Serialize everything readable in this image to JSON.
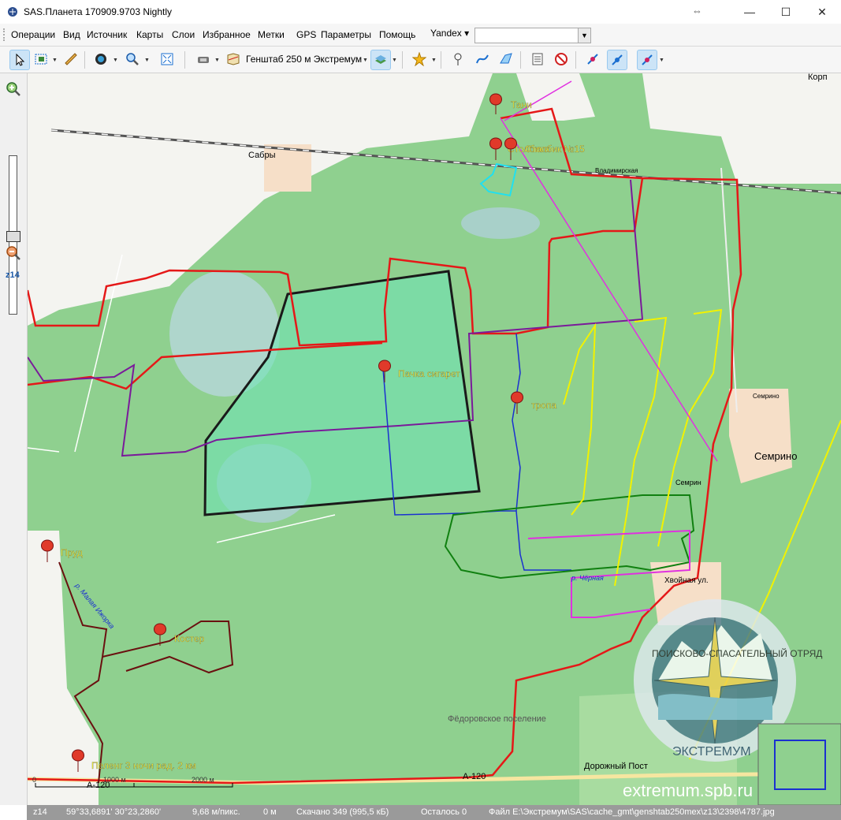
{
  "window": {
    "title": "SAS.Планета 170909.9703 Nightly",
    "minimize": "—",
    "maximize": "☐",
    "close": "✕"
  },
  "menu": {
    "items": [
      "Операции",
      "Вид",
      "Источник",
      "Карты",
      "Слои",
      "Избранное",
      "Метки",
      "GPS",
      "Параметры",
      "Помощь"
    ],
    "search_provider": "Yandex ▾",
    "search_value": ""
  },
  "toolbar": {
    "map_type": "Генштаб 250 м Экстремум"
  },
  "zoom": {
    "level_label": "z14"
  },
  "markers": [
    {
      "label": "Тани"
    },
    {
      "label": "Столбика"
    },
    {
      "label": "Столбик №15"
    },
    {
      "label": "Пачка сигарет"
    },
    {
      "label": "тропа"
    },
    {
      "label": "Пруд"
    },
    {
      "label": "Костер"
    },
    {
      "label": "Пеленг 3 ночи рад. 2 км"
    }
  ],
  "places": {
    "sabry": "Сабры",
    "semrino": "Семрино",
    "semrino_small": "Семрино",
    "semrin_partial": "Семрин",
    "khvoinaya": "Хвойная ул.",
    "dorozhny_post": "Дорожный Пост",
    "fedoritsa": "Фёдоровское поселение",
    "vladimirskaya": "Владимирская",
    "river_chernaya": "р. Чёрная",
    "river_left": "р. Малая Ижорка",
    "road1": "А-120",
    "road2": "А-120",
    "korpus": "Корп"
  },
  "scale": {
    "zero": "0",
    "mid": "1000 м",
    "end": "2000 м"
  },
  "watermark": "extremum.spb.ru",
  "emblem": {
    "top_text": "ПОИСКОВО-СПАСАТЕЛЬНЫЙ ОТРЯД",
    "bottom_text": "ЭКСТРЕМУМ"
  },
  "status": {
    "zoom": "z14",
    "coords": "59°33,6891' 30°23,2860'",
    "resolution": "9,68 м/пикс.",
    "distance": "0 м",
    "downloaded": "Скачано 349 (995,5 кБ)",
    "remaining": "Осталось 0",
    "file": "Файл E:\\Экстремум\\SAS\\cache_gmt\\genshtab250mex\\z13\\2398\\4787.jpg"
  },
  "colors": {
    "forest": "#8fd08f",
    "open": "#f4f4f0",
    "track_red": "#e51818",
    "track_purple": "#7a1a9a",
    "track_yellow": "#f2f200",
    "track_green": "#108010",
    "track_magenta": "#e030e0",
    "track_blue": "#1a30d0",
    "search_area": "#6fe3b4"
  }
}
